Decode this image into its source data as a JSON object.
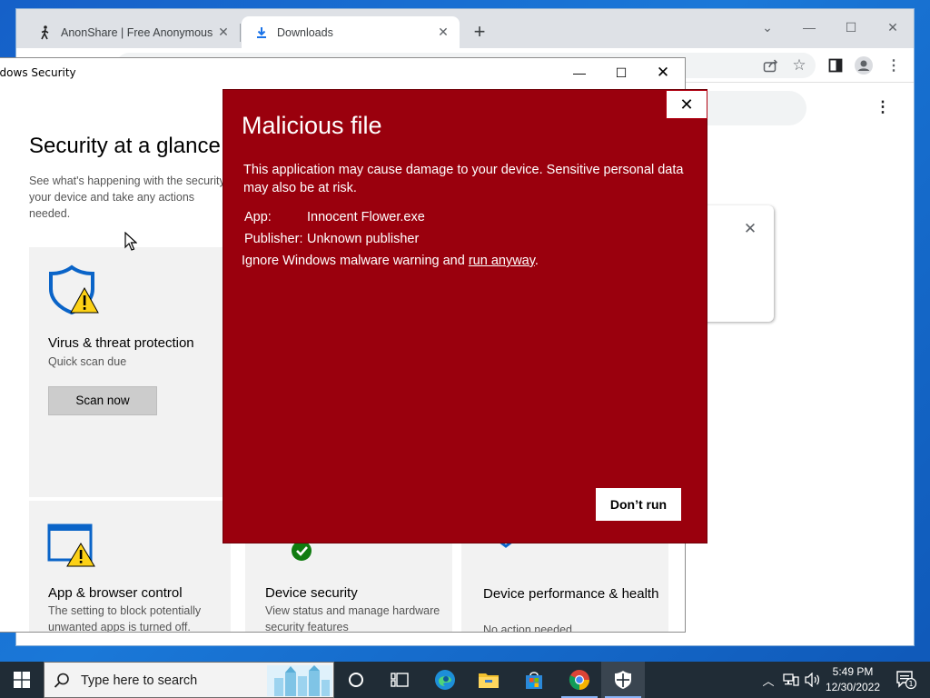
{
  "browser": {
    "tabs": [
      {
        "label": "AnonShare | Free Anonymous Fil",
        "icon": "walking-person-icon"
      },
      {
        "label": "Downloads",
        "icon": "download-icon",
        "active": true
      }
    ]
  },
  "windows_security": {
    "window_title": "Windows Security",
    "heading": "Security at a glance",
    "subtitle": "See what's happening with the security of your device and take any actions needed.",
    "cards": {
      "virus": {
        "title": "Virus & threat protection",
        "status": "Quick scan due",
        "action_label": "Scan now",
        "icon": "shield-warning-icon"
      },
      "app_browser": {
        "title": "App & browser control",
        "status": "The setting to block potentially unwanted apps is turned off.",
        "icon": "app-browser-warning-icon"
      },
      "device_security": {
        "title": "Device security",
        "status": "View status and manage hardware security features",
        "icon": "device-security-check-icon"
      },
      "performance": {
        "title": "Device performance & health",
        "status": "No action needed.",
        "icon": "heart-icon"
      }
    }
  },
  "malicious_dialog": {
    "title": "Malicious file",
    "description": "This application may cause damage to your device. Sensitive personal data may also be at risk.",
    "app_label": "App:",
    "app_value": "Innocent Flower.exe",
    "publisher_label": "Publisher:",
    "publisher_value": "Unknown publisher",
    "ignore_text": "Ignore Windows malware warning and ",
    "run_anyway_label": "run anyway",
    "ignore_suffix": ".",
    "dont_run_label": "Don’t run",
    "background_color": "#9a000d"
  },
  "taskbar": {
    "search_placeholder": "Type here to search",
    "clock_time": "5:49 PM",
    "clock_date": "12/30/2022",
    "notification_count": "1",
    "apps": [
      "cortana-icon",
      "task-view-icon",
      "edge-icon",
      "file-explorer-icon",
      "store-icon",
      "chrome-icon",
      "windows-security-icon"
    ]
  }
}
